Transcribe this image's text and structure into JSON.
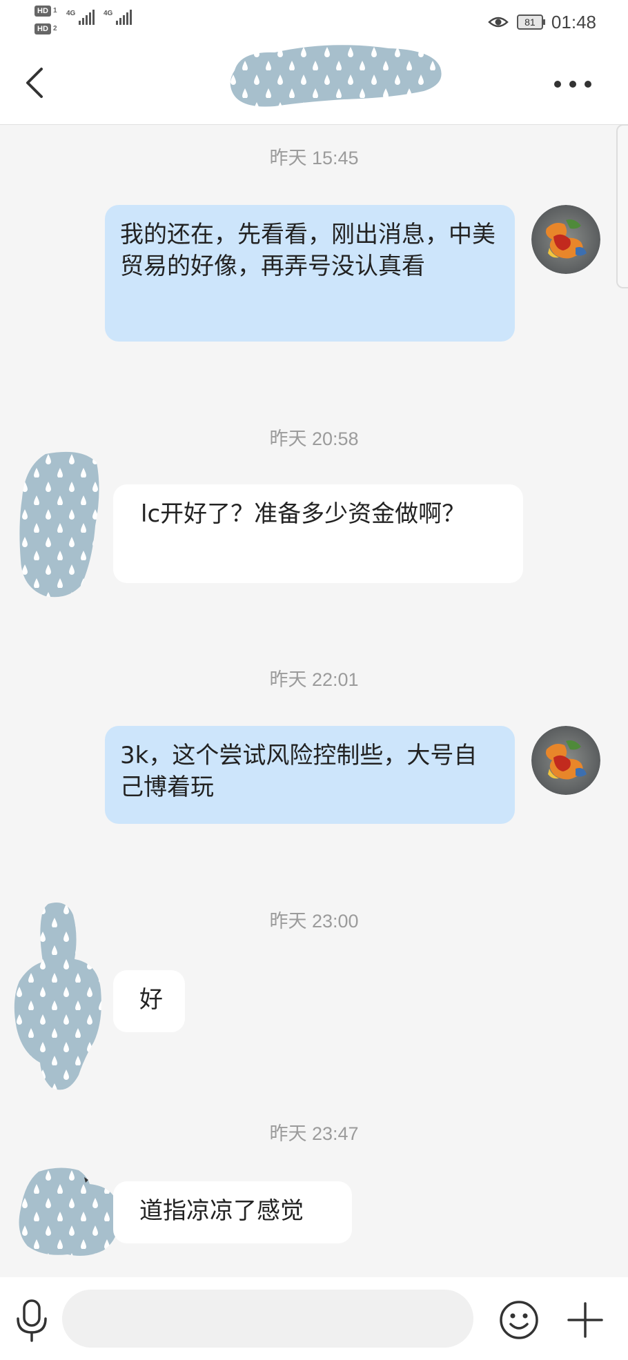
{
  "status_bar": {
    "hd1": "HD",
    "hd1_sub": "1",
    "hd2": "HD",
    "hd2_sub": "2",
    "net1": "4G",
    "net2": "4G",
    "battery": "81",
    "time": "01:48"
  },
  "messages": [
    {
      "time": "昨天 15:45",
      "side": "out",
      "text": "我的还在，先看看，刚出消息，中美贸易的好像，再弄号没认真看"
    },
    {
      "time": "昨天 20:58",
      "side": "in",
      "text": "lc开好了？准备多少资金做啊？"
    },
    {
      "time": "昨天 22:01",
      "side": "out",
      "text": "3k，这个尝试风险控制些，大号自己博着玩"
    },
    {
      "time": "昨天 23:00",
      "side": "in",
      "text": "好"
    },
    {
      "time": "昨天 23:47",
      "side": "in",
      "text": "道指凉凉了感觉"
    }
  ],
  "input": {
    "value": "",
    "placeholder": ""
  },
  "colors": {
    "outgoing_bubble": "#cde5fb",
    "incoming_bubble": "#ffffff",
    "background": "#f5f5f5",
    "redaction": "#a7bfcc"
  },
  "icons": {
    "back": "chevron-left-icon",
    "more": "more-icon",
    "mic": "microphone-icon",
    "emoji": "smiley-icon",
    "plus": "plus-icon",
    "eye": "eye-icon"
  }
}
